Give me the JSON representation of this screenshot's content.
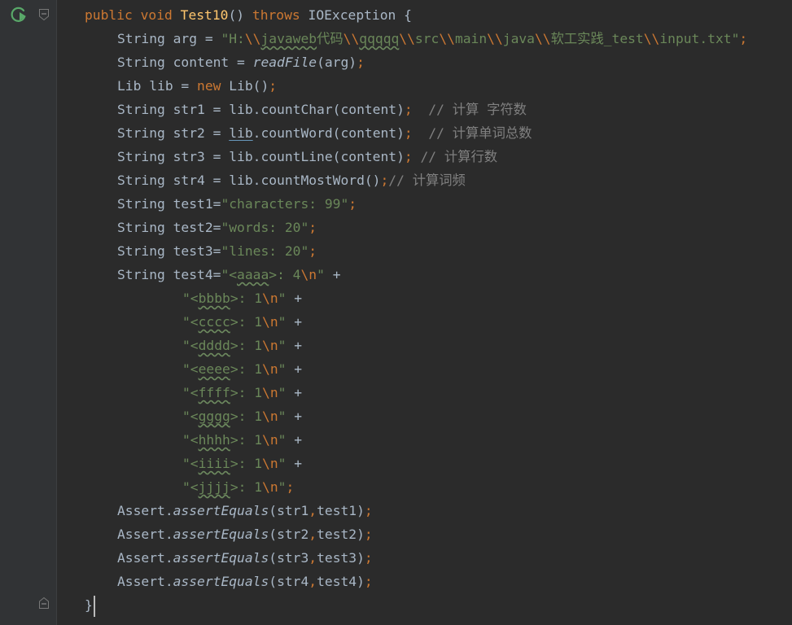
{
  "editor": {
    "lines": [
      {
        "indent": 104,
        "tokens": [
          {
            "t": "public void ",
            "c": "kw"
          },
          {
            "t": "Test10",
            "c": "fn"
          },
          {
            "t": "() ",
            "c": "pl"
          },
          {
            "t": "throws ",
            "c": "kw"
          },
          {
            "t": "IOException {",
            "c": "pl"
          }
        ]
      },
      {
        "indent": 144,
        "tokens": [
          {
            "t": "String arg = ",
            "c": "pl"
          },
          {
            "t": "\"H:",
            "c": "str"
          },
          {
            "t": "\\\\",
            "c": "esc"
          },
          {
            "t": "javaweb",
            "c": "str wavy"
          },
          {
            "t": "代码",
            "c": "str"
          },
          {
            "t": "\\\\",
            "c": "esc"
          },
          {
            "t": "qqqqq",
            "c": "str wavy"
          },
          {
            "t": "\\\\",
            "c": "esc"
          },
          {
            "t": "src",
            "c": "str"
          },
          {
            "t": "\\\\",
            "c": "esc"
          },
          {
            "t": "main",
            "c": "str"
          },
          {
            "t": "\\\\",
            "c": "esc"
          },
          {
            "t": "java",
            "c": "str"
          },
          {
            "t": "\\\\",
            "c": "esc"
          },
          {
            "t": "软工实践_test",
            "c": "str"
          },
          {
            "t": "\\\\",
            "c": "esc"
          },
          {
            "t": "input.txt\"",
            "c": "str"
          },
          {
            "t": ";",
            "c": "kw"
          }
        ]
      },
      {
        "indent": 144,
        "tokens": [
          {
            "t": "String content = ",
            "c": "pl"
          },
          {
            "t": "readFile",
            "c": "pl it"
          },
          {
            "t": "(arg)",
            "c": "pl"
          },
          {
            "t": ";",
            "c": "kw"
          }
        ]
      },
      {
        "indent": 144,
        "tokens": [
          {
            "t": "Lib lib = ",
            "c": "pl"
          },
          {
            "t": "new ",
            "c": "kw"
          },
          {
            "t": "Lib()",
            "c": "pl"
          },
          {
            "t": ";",
            "c": "kw"
          }
        ]
      },
      {
        "indent": 144,
        "tokens": [
          {
            "t": "String str1 = lib.countChar(content)",
            "c": "pl"
          },
          {
            "t": ";",
            "c": "kw"
          },
          {
            "t": "  // 计算 字符数",
            "c": "cm"
          }
        ]
      },
      {
        "indent": 144,
        "tokens": [
          {
            "t": "String str2 = ",
            "c": "pl"
          },
          {
            "t": "lib",
            "c": "ulink"
          },
          {
            "t": ".countWord(content)",
            "c": "pl"
          },
          {
            "t": ";",
            "c": "kw"
          },
          {
            "t": "  // 计算单词总数",
            "c": "cm"
          }
        ]
      },
      {
        "indent": 144,
        "tokens": [
          {
            "t": "String str3 = lib.countLine(content)",
            "c": "pl"
          },
          {
            "t": ";",
            "c": "kw"
          },
          {
            "t": " // 计算行数",
            "c": "cm"
          }
        ]
      },
      {
        "indent": 144,
        "tokens": [
          {
            "t": "String str4 = lib.countMostWord()",
            "c": "pl"
          },
          {
            "t": ";",
            "c": "kw"
          },
          {
            "t": "// 计算词频",
            "c": "cm"
          }
        ]
      },
      {
        "indent": 144,
        "tokens": [
          {
            "t": "String test1=",
            "c": "pl"
          },
          {
            "t": "\"characters: 99\"",
            "c": "str"
          },
          {
            "t": ";",
            "c": "kw"
          }
        ]
      },
      {
        "indent": 144,
        "tokens": [
          {
            "t": "String test2=",
            "c": "pl"
          },
          {
            "t": "\"words: 20\"",
            "c": "str"
          },
          {
            "t": ";",
            "c": "kw"
          }
        ]
      },
      {
        "indent": 144,
        "tokens": [
          {
            "t": "String test3=",
            "c": "pl"
          },
          {
            "t": "\"lines: 20\"",
            "c": "str"
          },
          {
            "t": ";",
            "c": "kw"
          }
        ]
      },
      {
        "indent": 144,
        "tokens": [
          {
            "t": "String test4=",
            "c": "pl"
          },
          {
            "t": "\"<",
            "c": "str"
          },
          {
            "t": "aaaa",
            "c": "str wavy"
          },
          {
            "t": ">: 4",
            "c": "str"
          },
          {
            "t": "\\n",
            "c": "esc"
          },
          {
            "t": "\" ",
            "c": "str"
          },
          {
            "t": "+",
            "c": "pl"
          }
        ]
      },
      {
        "indent": 224,
        "tokens": [
          {
            "t": "\"<",
            "c": "str"
          },
          {
            "t": "bbbb",
            "c": "str wavy"
          },
          {
            "t": ">: 1",
            "c": "str"
          },
          {
            "t": "\\n",
            "c": "esc"
          },
          {
            "t": "\" ",
            "c": "str"
          },
          {
            "t": "+",
            "c": "pl"
          }
        ]
      },
      {
        "indent": 224,
        "tokens": [
          {
            "t": "\"<",
            "c": "str"
          },
          {
            "t": "cccc",
            "c": "str wavy"
          },
          {
            "t": ">: 1",
            "c": "str"
          },
          {
            "t": "\\n",
            "c": "esc"
          },
          {
            "t": "\" ",
            "c": "str"
          },
          {
            "t": "+",
            "c": "pl"
          }
        ]
      },
      {
        "indent": 224,
        "tokens": [
          {
            "t": "\"<",
            "c": "str"
          },
          {
            "t": "dddd",
            "c": "str wavy"
          },
          {
            "t": ">: 1",
            "c": "str"
          },
          {
            "t": "\\n",
            "c": "esc"
          },
          {
            "t": "\" ",
            "c": "str"
          },
          {
            "t": "+",
            "c": "pl"
          }
        ]
      },
      {
        "indent": 224,
        "tokens": [
          {
            "t": "\"<",
            "c": "str"
          },
          {
            "t": "eeee",
            "c": "str wavy"
          },
          {
            "t": ">: 1",
            "c": "str"
          },
          {
            "t": "\\n",
            "c": "esc"
          },
          {
            "t": "\" ",
            "c": "str"
          },
          {
            "t": "+",
            "c": "pl"
          }
        ]
      },
      {
        "indent": 224,
        "tokens": [
          {
            "t": "\"<",
            "c": "str"
          },
          {
            "t": "ffff",
            "c": "str wavy"
          },
          {
            "t": ">: 1",
            "c": "str"
          },
          {
            "t": "\\n",
            "c": "esc"
          },
          {
            "t": "\" ",
            "c": "str"
          },
          {
            "t": "+",
            "c": "pl"
          }
        ]
      },
      {
        "indent": 224,
        "tokens": [
          {
            "t": "\"<",
            "c": "str"
          },
          {
            "t": "gggg",
            "c": "str wavy"
          },
          {
            "t": ">: 1",
            "c": "str"
          },
          {
            "t": "\\n",
            "c": "esc"
          },
          {
            "t": "\" ",
            "c": "str"
          },
          {
            "t": "+",
            "c": "pl"
          }
        ]
      },
      {
        "indent": 224,
        "tokens": [
          {
            "t": "\"<",
            "c": "str"
          },
          {
            "t": "hhhh",
            "c": "str wavy"
          },
          {
            "t": ">: 1",
            "c": "str"
          },
          {
            "t": "\\n",
            "c": "esc"
          },
          {
            "t": "\" ",
            "c": "str"
          },
          {
            "t": "+",
            "c": "pl"
          }
        ]
      },
      {
        "indent": 224,
        "tokens": [
          {
            "t": "\"<",
            "c": "str"
          },
          {
            "t": "iiii",
            "c": "str wavy"
          },
          {
            "t": ">: 1",
            "c": "str"
          },
          {
            "t": "\\n",
            "c": "esc"
          },
          {
            "t": "\" ",
            "c": "str"
          },
          {
            "t": "+",
            "c": "pl"
          }
        ]
      },
      {
        "indent": 224,
        "tokens": [
          {
            "t": "\"<",
            "c": "str"
          },
          {
            "t": "jjjj",
            "c": "str wavy"
          },
          {
            "t": ">: 1",
            "c": "str"
          },
          {
            "t": "\\n",
            "c": "esc"
          },
          {
            "t": "\"",
            "c": "str"
          },
          {
            "t": ";",
            "c": "kw"
          }
        ]
      },
      {
        "indent": 144,
        "tokens": [
          {
            "t": "Assert.",
            "c": "pl"
          },
          {
            "t": "assertEquals",
            "c": "pl it"
          },
          {
            "t": "(str1",
            "c": "pl"
          },
          {
            "t": ",",
            "c": "kw"
          },
          {
            "t": "test1)",
            "c": "pl"
          },
          {
            "t": ";",
            "c": "kw"
          }
        ]
      },
      {
        "indent": 144,
        "tokens": [
          {
            "t": "Assert.",
            "c": "pl"
          },
          {
            "t": "assertEquals",
            "c": "pl it"
          },
          {
            "t": "(str2",
            "c": "pl"
          },
          {
            "t": ",",
            "c": "kw"
          },
          {
            "t": "test2)",
            "c": "pl"
          },
          {
            "t": ";",
            "c": "kw"
          }
        ]
      },
      {
        "indent": 144,
        "tokens": [
          {
            "t": "Assert.",
            "c": "pl"
          },
          {
            "t": "assertEquals",
            "c": "pl it"
          },
          {
            "t": "(str3",
            "c": "pl"
          },
          {
            "t": ",",
            "c": "kw"
          },
          {
            "t": "test3)",
            "c": "pl"
          },
          {
            "t": ";",
            "c": "kw"
          }
        ]
      },
      {
        "indent": 144,
        "tokens": [
          {
            "t": "Assert.",
            "c": "pl"
          },
          {
            "t": "assertEquals",
            "c": "pl it"
          },
          {
            "t": "(str4",
            "c": "pl"
          },
          {
            "t": ",",
            "c": "kw"
          },
          {
            "t": "test4)",
            "c": "pl"
          },
          {
            "t": ";",
            "c": "kw"
          }
        ]
      },
      {
        "indent": 104,
        "tokens": [
          {
            "t": "}",
            "c": "pl"
          }
        ],
        "caret": true
      }
    ],
    "colors": {
      "background": "#2b2b2b",
      "gutter": "#313335",
      "keyword": "#cc7832",
      "string": "#6a8759",
      "function": "#ffc66d",
      "comment": "#808080",
      "text": "#a9b7c6"
    },
    "icons": [
      "run-test-icon",
      "fold-start-icon",
      "fold-end-icon"
    ]
  }
}
